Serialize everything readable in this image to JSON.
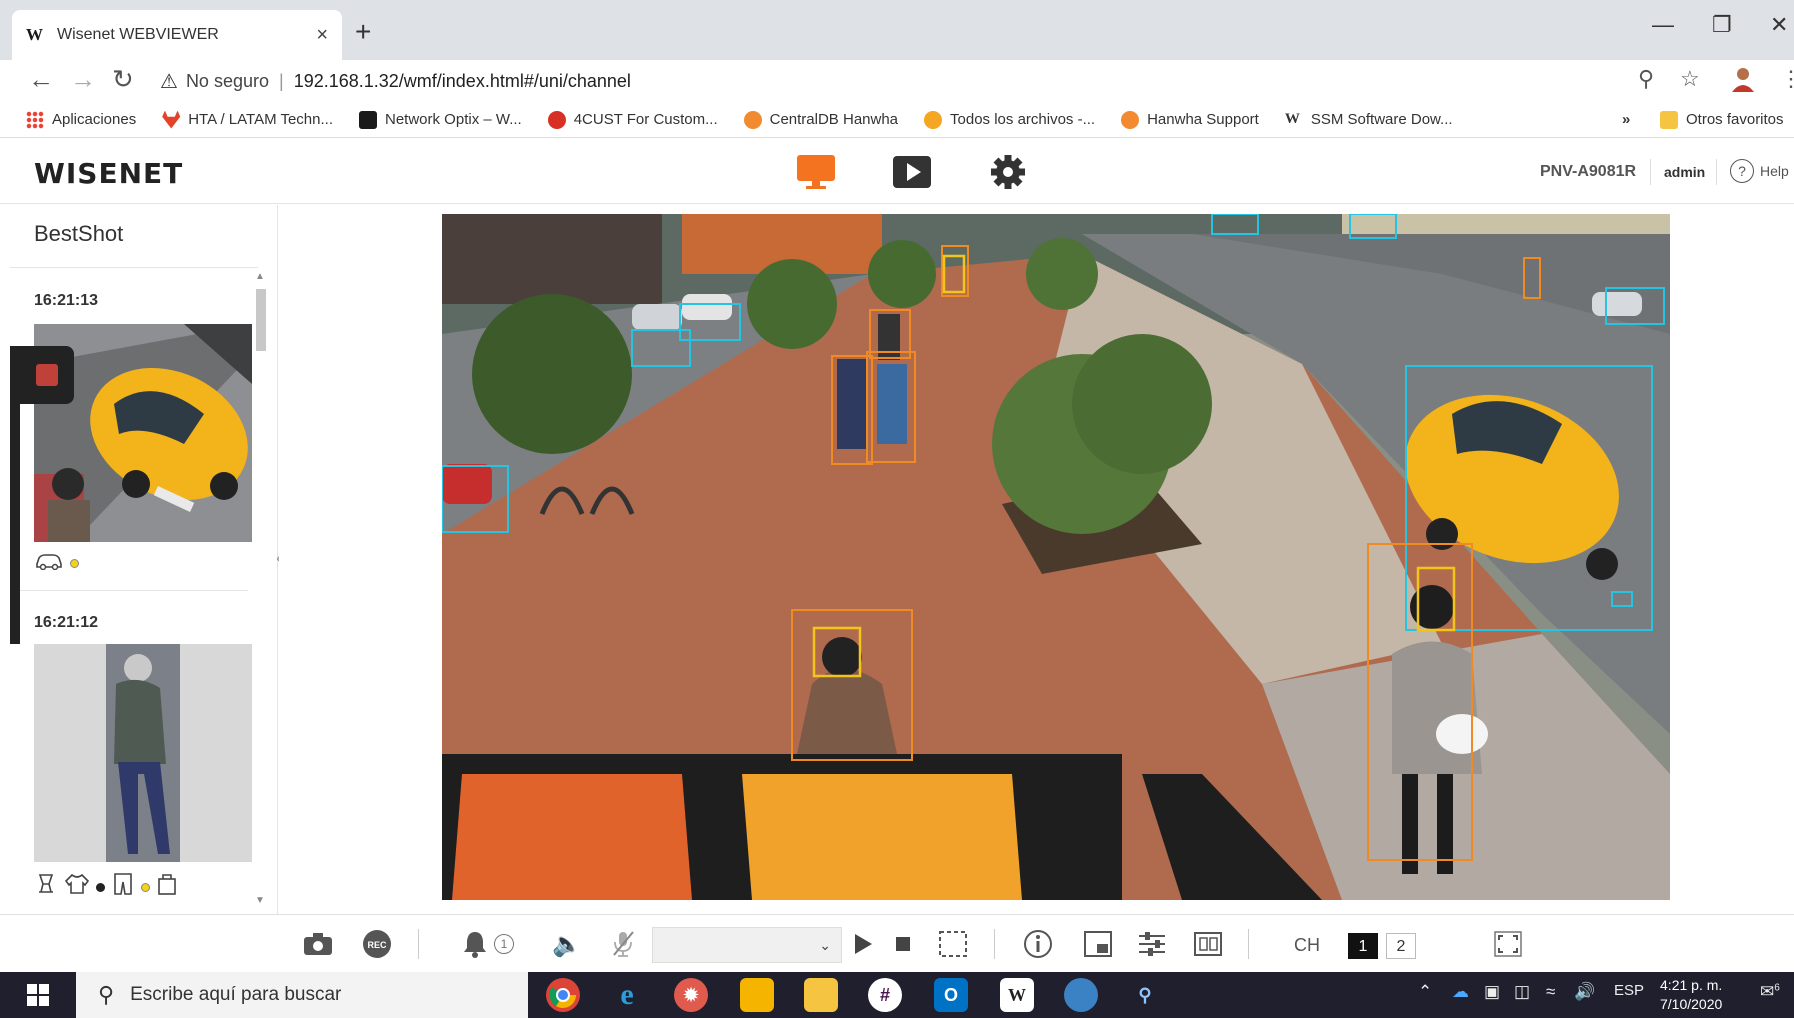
{
  "browser": {
    "tab_title": "Wisenet WEBVIEWER",
    "tab_favicon": "W",
    "tab_close": "×",
    "new_tab": "+",
    "security_label": "No seguro",
    "url": "192.168.1.32/wmf/index.html#/uni/channel",
    "bookmarks": [
      {
        "label": "Aplicaciones",
        "color": "#4285f4"
      },
      {
        "label": "HTA / LATAM Techn...",
        "color": "#e2432a"
      },
      {
        "label": "Network Optix – W...",
        "color": "#1a1a1a"
      },
      {
        "label": "4CUST For Custom...",
        "color": "#d93025"
      },
      {
        "label": "CentralDB Hanwha",
        "color": "#f28b30"
      },
      {
        "label": "Todos los archivos -...",
        "color": "#f5a623"
      },
      {
        "label": "Hanwha Support",
        "color": "#f28b30"
      },
      {
        "label": "SSM Software Dow...",
        "color": "#1a1a1a"
      }
    ],
    "bookmarks_overflow": "»",
    "other_bookmarks": "Otros favoritos"
  },
  "app": {
    "logo": "WISENET",
    "model": "PNV-A9081R",
    "user": "admin",
    "help": "Help",
    "accent": "#f37321"
  },
  "bestshot": {
    "title": "BestShot",
    "items": [
      {
        "time": "16:21:13"
      },
      {
        "time": "16:21:12"
      }
    ]
  },
  "controls": {
    "alarm_count": "1",
    "ch_label": "CH",
    "channels": [
      "1",
      "2"
    ]
  },
  "taskbar": {
    "search_placeholder": "Escribe aquí para buscar",
    "language": "ESP",
    "time": "4:21 p. m.",
    "date": "7/10/2020",
    "notifications": "6"
  }
}
